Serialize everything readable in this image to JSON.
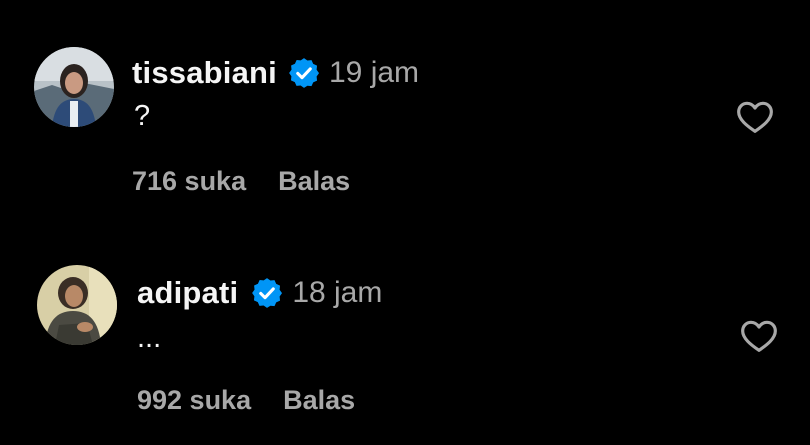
{
  "comments": [
    {
      "username": "tissabiani",
      "verified_icon": "verified-badge-icon",
      "time": "19 jam",
      "text": "?",
      "likes": "716 suka",
      "reply_label": "Balas",
      "like_icon": "heart-outline-icon"
    },
    {
      "username": "adipati",
      "verified_icon": "verified-badge-icon",
      "time": "18 jam",
      "text": "...",
      "likes": "992 suka",
      "reply_label": "Balas",
      "like_icon": "heart-outline-icon"
    }
  ],
  "colors": {
    "background": "#000000",
    "primary_text": "#f5f5f5",
    "secondary_text": "#a8a8a8",
    "verified": "#0095f6"
  }
}
